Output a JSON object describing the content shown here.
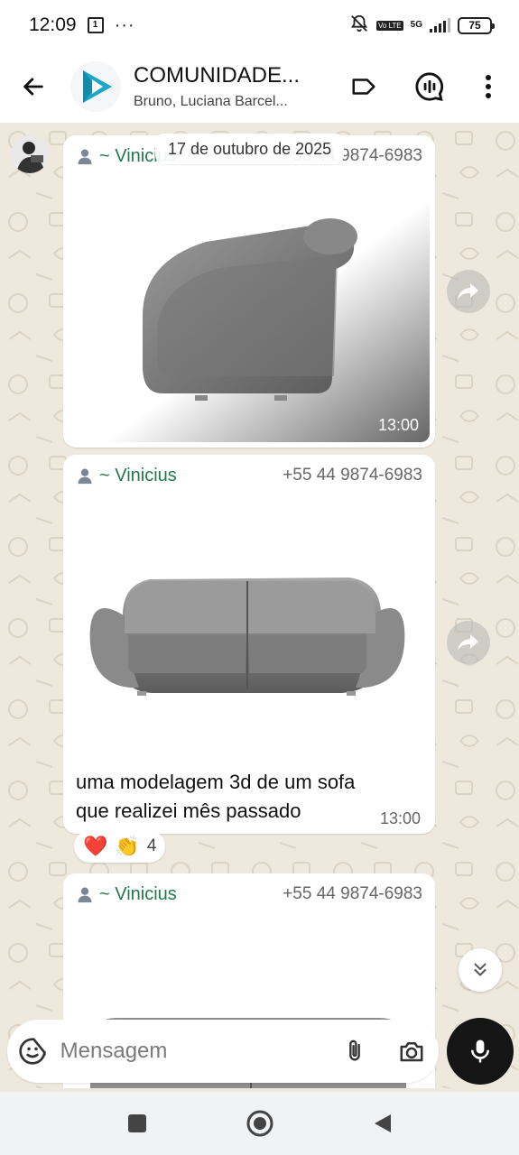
{
  "status_bar": {
    "time": "12:09",
    "calendar_badge": "1",
    "more_dots": "···",
    "volte": "Vo LTE",
    "network": "5G",
    "battery": "75"
  },
  "header": {
    "title": "COMUNIDADE...",
    "members": "Bruno, Luciana Barcel..."
  },
  "chat": {
    "date_chip": "17 de outubro de 2025",
    "messages": [
      {
        "sender": "~ Vinicius",
        "phone": "+55 44 9874-6983",
        "image_alt": "armchair-3d-render",
        "time": "13:00"
      },
      {
        "sender": "~ Vinicius",
        "phone": "+55 44 9874-6983",
        "image_alt": "sofa-3d-render",
        "caption": "uma modelagem 3d de um sofa que realizei mês passado",
        "time": "13:00",
        "reactions": {
          "emojis": [
            "❤️",
            "👏"
          ],
          "count": "4"
        }
      },
      {
        "sender": "~ Vinicius",
        "phone": "+55 44 9874-6983",
        "image_alt": "sofa-3d-render-partial"
      }
    ]
  },
  "compose": {
    "placeholder": "Mensagem"
  },
  "colors": {
    "sender_name": "#1f7a4c",
    "wallpaper": "#efe8dc",
    "brand_logo": "#1ca7c9"
  },
  "icons": {
    "back": "arrow-left-icon",
    "label": "label-tag-icon",
    "call": "voice-chat-icon",
    "menu": "more-vert-icon",
    "forward": "forward-icon",
    "scroll": "double-chevron-down-icon",
    "sticker": "sticker-icon",
    "attach": "paperclip-icon",
    "camera": "camera-icon",
    "mic": "mic-icon"
  }
}
